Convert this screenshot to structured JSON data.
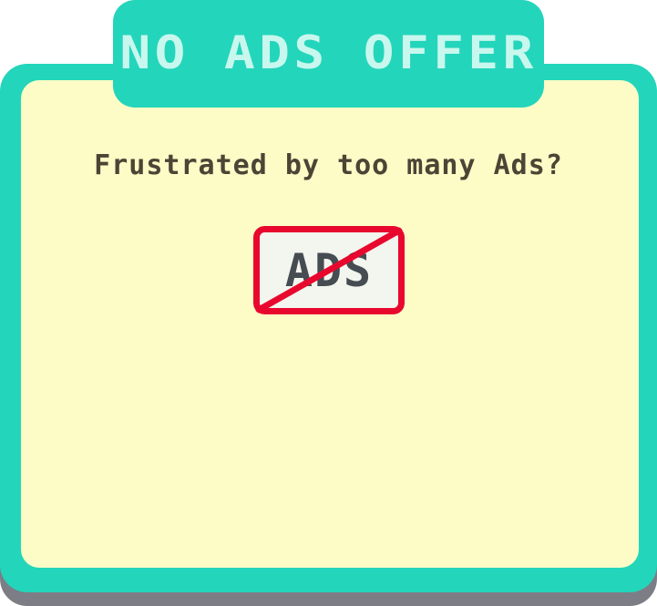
{
  "title": "NO ADS OFFER",
  "question": "Frustrated by too many Ads?",
  "sign": {
    "icon": "no-ads-icon",
    "label": "ADS"
  },
  "colors": {
    "frame": "#23d5bb",
    "frame_shadow": "#7d7d85",
    "panel_fill": "#fdfcc7",
    "title_text": "#c8f7ee",
    "question_text": "#4a4535",
    "sign_border": "#e8082e",
    "sign_fill": "#f3f5ef",
    "sign_text": "#454c52"
  }
}
